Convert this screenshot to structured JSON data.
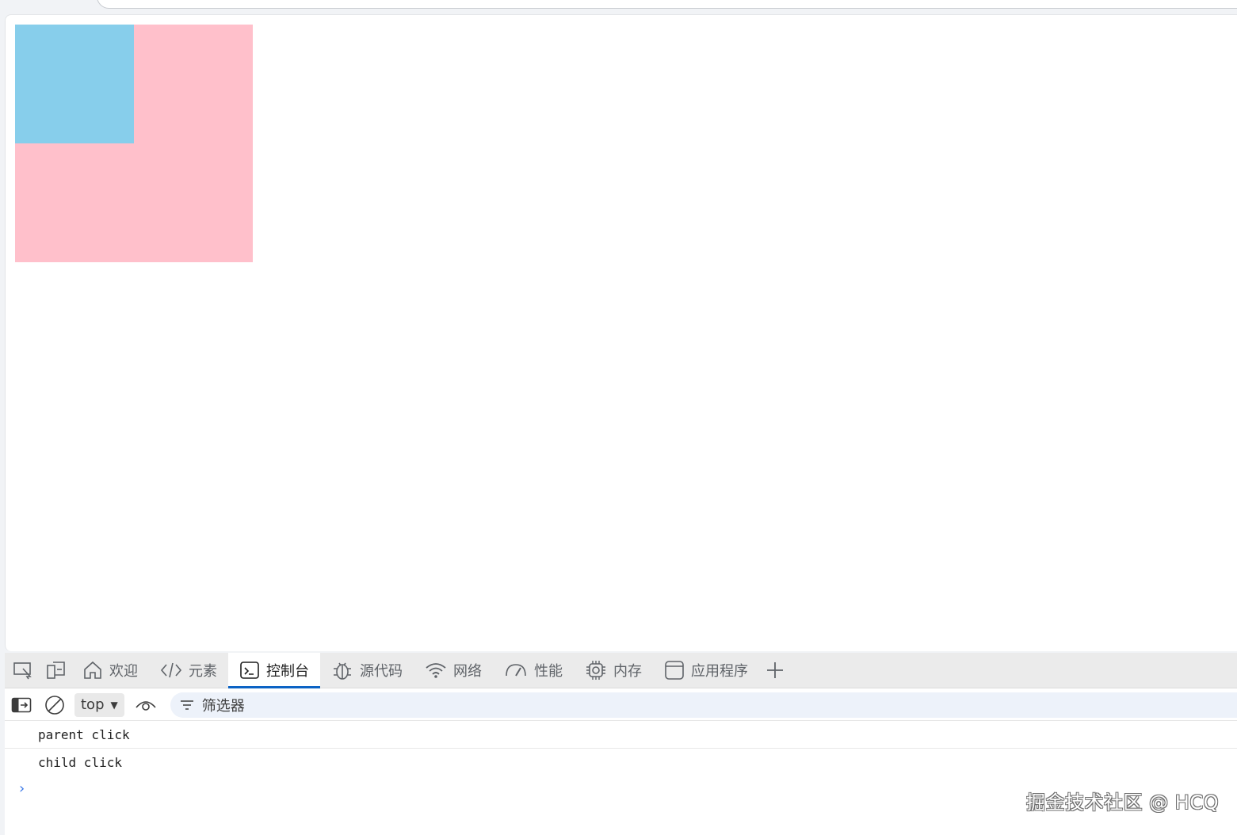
{
  "colors": {
    "parent_box": "#ffc0cb",
    "child_box": "#87ceeb",
    "active_tab_underline": "#0b63c5"
  },
  "devtools": {
    "tool_icons": [
      {
        "name": "inspect-element-icon"
      },
      {
        "name": "device-emulation-icon"
      }
    ],
    "tabs": [
      {
        "label": "欢迎",
        "icon": "home-icon",
        "active": false
      },
      {
        "label": "元素",
        "icon": "code-brackets-icon",
        "active": false
      },
      {
        "label": "控制台",
        "icon": "console-icon",
        "active": true
      },
      {
        "label": "源代码",
        "icon": "bug-icon",
        "active": false
      },
      {
        "label": "网络",
        "icon": "wifi-icon",
        "active": false
      },
      {
        "label": "性能",
        "icon": "gauge-icon",
        "active": false
      },
      {
        "label": "内存",
        "icon": "chip-icon",
        "active": false
      },
      {
        "label": "应用程序",
        "icon": "application-window-icon",
        "active": false
      }
    ],
    "add_tab_icon": "plus-icon",
    "toolbar": {
      "sidebar_icon": "sidebar-toggle-icon",
      "clear_icon": "clear-console-icon",
      "context": "top",
      "eye_icon": "live-expression-icon",
      "filter_icon": "filter-icon",
      "filter_placeholder": "筛选器"
    },
    "console": {
      "logs": [
        "parent click",
        "child click"
      ],
      "prompt": "›"
    }
  },
  "watermark": "掘金技术社区 @ HCQ"
}
